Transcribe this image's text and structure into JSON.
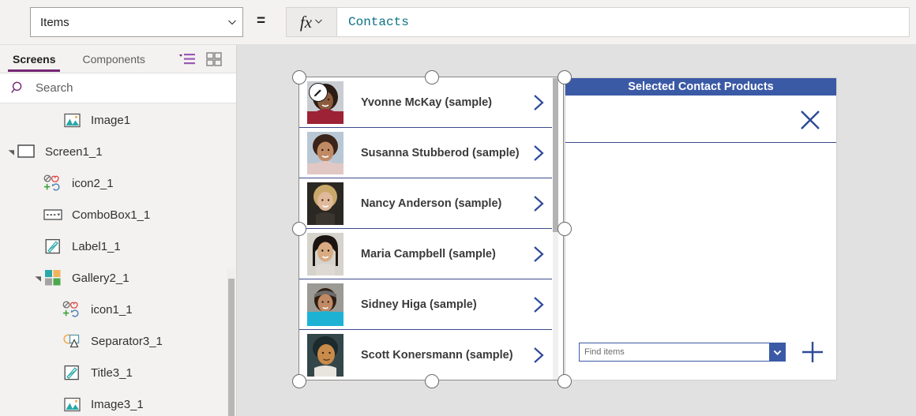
{
  "formula_bar": {
    "property_selected": "Items",
    "equals": "=",
    "fx_label": "fx",
    "formula_value": "Contacts"
  },
  "sidebar": {
    "tabs": [
      {
        "label": "Screens",
        "active": true
      },
      {
        "label": "Components",
        "active": false
      }
    ],
    "view_icons": [
      {
        "name": "tree-view-icon",
        "color": "#742774"
      },
      {
        "name": "grid-view-icon",
        "color": "#8a8886"
      }
    ],
    "search": {
      "placeholder": "Search",
      "icon": "search-icon"
    },
    "tree": [
      {
        "label": "Image1",
        "icon": "image-icon",
        "indent": 2,
        "twisty": "none"
      },
      {
        "label": "Screen1_1",
        "icon": "screen-icon",
        "indent": 0,
        "twisty": "expanded"
      },
      {
        "label": "icon2_1",
        "icon": "icon-icon",
        "indent": 1,
        "twisty": "none"
      },
      {
        "label": "ComboBox1_1",
        "icon": "combobox-icon",
        "indent": 1,
        "twisty": "none"
      },
      {
        "label": "Label1_1",
        "icon": "label-icon",
        "indent": 1,
        "twisty": "none"
      },
      {
        "label": "Gallery2_1",
        "icon": "gallery-icon",
        "indent": 1,
        "twisty": "expanded"
      },
      {
        "label": "icon1_1",
        "icon": "icon-icon",
        "indent": 2,
        "twisty": "none"
      },
      {
        "label": "Separator3_1",
        "icon": "separator-icon",
        "indent": 2,
        "twisty": "none"
      },
      {
        "label": "Title3_1",
        "icon": "label-icon",
        "indent": 2,
        "twisty": "none"
      },
      {
        "label": "Image3_1",
        "icon": "image-icon",
        "indent": 2,
        "twisty": "none"
      }
    ]
  },
  "canvas": {
    "gallery": {
      "name": "contacts-gallery",
      "edit_badge_icon": "pencil-icon",
      "items": [
        {
          "name": "Yvonne McKay (sample)",
          "chevron": "chevron-right-icon",
          "hair": "#2a1c14",
          "skin": "#8b5a3c",
          "bg": "#c9cdd2",
          "cloth": "#9d2235"
        },
        {
          "name": "Susanna Stubberod (sample)",
          "chevron": "chevron-right-icon",
          "hair": "#3a2318",
          "skin": "#c08a64",
          "bg": "#b9c7d4",
          "cloth": "#e2c8c4"
        },
        {
          "name": "Nancy Anderson (sample)",
          "chevron": "chevron-right-icon",
          "hair": "#c9a86a",
          "skin": "#e0b89a",
          "bg": "#2b2722",
          "cloth": "#3b3630"
        },
        {
          "name": "Maria Campbell (sample)",
          "chevron": "chevron-right-icon",
          "hair": "#1b1410",
          "skin": "#d8ab83",
          "bg": "#d5d3cc",
          "cloth": "#ded9d2"
        },
        {
          "name": "Sidney Higa (sample)",
          "chevron": "chevron-right-icon",
          "hair": "#6d6a68",
          "skin": "#c08a64",
          "bg": "#9c9a95",
          "cloth": "#1db2d4"
        },
        {
          "name": "Scott Konersmann (sample)",
          "chevron": "chevron-right-icon",
          "hair": "#1c2a2c",
          "skin": "#c98b4a",
          "bg": "#33464a",
          "cloth": "#e8e5de"
        }
      ]
    },
    "side_panel": {
      "title": "Selected Contact Products",
      "close_icon": "close-x-icon",
      "find_combo": {
        "placeholder": "Find items",
        "dropdown_icon": "chevron-down-icon"
      },
      "add_icon": "plus-icon"
    }
  },
  "colors": {
    "accent_purple": "#742774",
    "panel_blue": "#3b5aa6",
    "formula_teal": "#0b7285",
    "canvas_bg": "#e1e1e1"
  }
}
